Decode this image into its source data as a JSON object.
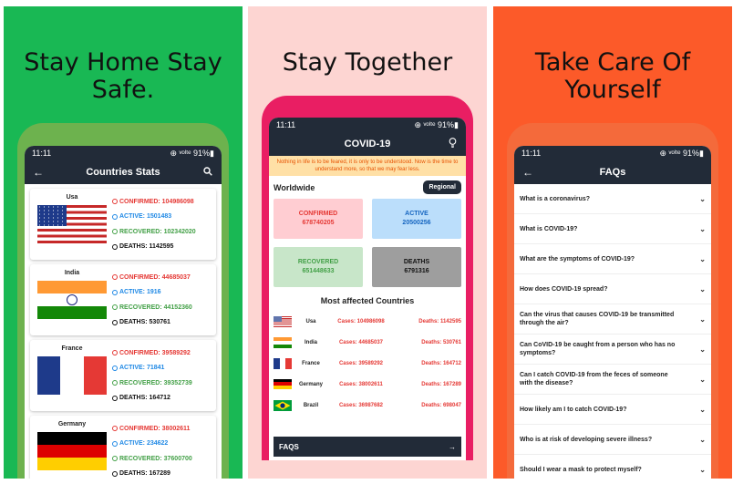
{
  "panel1": {
    "headline_line1": "Stay Home Stay",
    "headline_line2": "Safe.",
    "status": {
      "time": "11:11",
      "right": "⊕ ᵛᵒˡᵗᵉ 91%▮"
    },
    "appbar": {
      "title": "Countries Stats"
    },
    "countries": [
      {
        "name": "Usa",
        "confirmed": "CONFIRMED: 104986098",
        "active": "ACTIVE: 1501483",
        "recovered": "RECOVERED: 102342020",
        "deaths": "DEATHS: 1142595"
      },
      {
        "name": "India",
        "confirmed": "CONFIRMED: 44685037",
        "active": "ACTIVE: 1916",
        "recovered": "RECOVERED: 44152360",
        "deaths": "DEATHS: 530761"
      },
      {
        "name": "France",
        "confirmed": "CONFIRMED: 39589292",
        "active": "ACTIVE: 71841",
        "recovered": "RECOVERED: 39352739",
        "deaths": "DEATHS: 164712"
      },
      {
        "name": "Germany",
        "confirmed": "CONFIRMED: 38002611",
        "active": "ACTIVE: 234622",
        "recovered": "RECOVERED: 37600700",
        "deaths": "DEATHS: 167289"
      }
    ]
  },
  "panel2": {
    "headline": "Stay Together",
    "status": {
      "time": "11:11",
      "right": "⊕ ᵛᵒˡᵗᵉ 91%▮"
    },
    "appbar": {
      "title": "COVID-19"
    },
    "notice": "Nothing in life is to be feared, it is only to be understood. Now is the time to understand more, so that we may fear less.",
    "worldwide": "Worldwide",
    "regional": "Regional",
    "tiles": {
      "confirmed_label": "CONFIRMED",
      "confirmed_value": "678740205",
      "active_label": "ACTIVE",
      "active_value": "20500256",
      "recovered_label": "RECOVERED",
      "recovered_value": "651448633",
      "deaths_label": "DEATHS",
      "deaths_value": "6791316"
    },
    "most_affected_title": "Most affected Countries",
    "most_affected": [
      {
        "name": "Usa",
        "cases": "Cases: 104986098",
        "deaths": "Deaths: 1142595"
      },
      {
        "name": "India",
        "cases": "Cases: 44685037",
        "deaths": "Deaths: 530761"
      },
      {
        "name": "France",
        "cases": "Cases: 39589292",
        "deaths": "Deaths: 164712"
      },
      {
        "name": "Germany",
        "cases": "Cases: 38002611",
        "deaths": "Deaths: 167289"
      },
      {
        "name": "Brazil",
        "cases": "Cases: 36987682",
        "deaths": "Deaths: 698047"
      }
    ],
    "faqs_label": "FAQS"
  },
  "panel3": {
    "headline_line1": "Take Care Of",
    "headline_line2": "Yourself",
    "status": {
      "time": "11:11",
      "right": "⊕ ᵛᵒˡᵗᵉ 91%▮"
    },
    "appbar": {
      "title": "FAQs"
    },
    "faqs": [
      "What is a coronavirus?",
      "What is COVID-19?",
      "What are the symptoms of COVID-19?",
      "How does COVID-19 spread?",
      "Can the virus that causes COVID-19 be transmitted through the air?",
      "Can CoVID-19 be caught from a person who has no symptoms?",
      "Can I catch COVID-19 from the feces of someone with the disease?",
      "How likely am I to catch COVID-19?",
      "Who is at risk of developing severe illness?",
      "Should I wear a mask to protect myself?"
    ]
  }
}
